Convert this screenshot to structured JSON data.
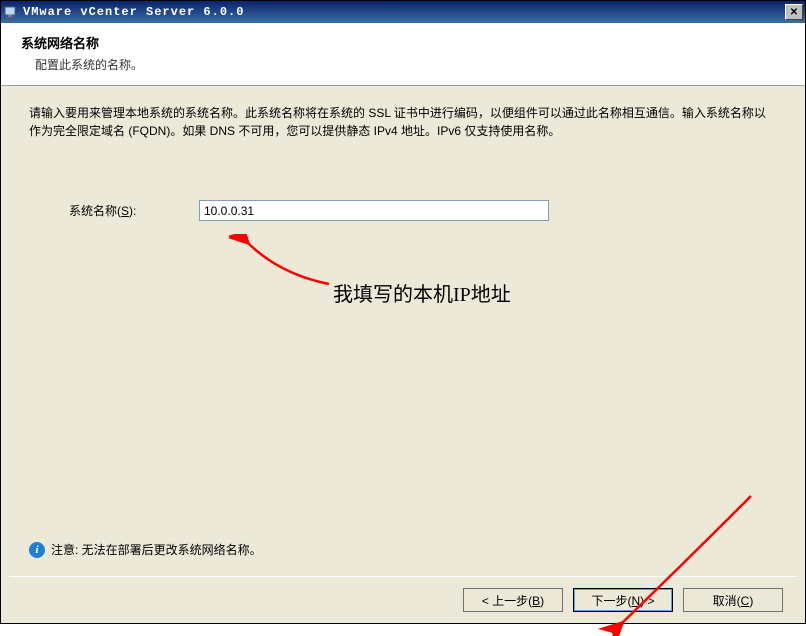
{
  "titlebar": {
    "text": "VMware vCenter Server 6.0.0"
  },
  "header": {
    "title": "系统网络名称",
    "subtitle": "配置此系统的名称。"
  },
  "content": {
    "description": "请输入要用来管理本地系统的系统名称。此系统名称将在系统的 SSL 证书中进行编码，以便组件可以通过此名称相互通信。输入系统名称以作为完全限定域名 (FQDN)。如果 DNS 不可用，您可以提供静态 IPv4 地址。IPv6 仅支持使用名称。",
    "form": {
      "label": "系统名称(S):",
      "value": "10.0.0.31"
    },
    "annotation": "我填写的本机IP地址",
    "note_prefix": "注意:",
    "note_text": " 无法在部署后更改系统网络名称。"
  },
  "buttons": {
    "back": "< 上一步(B)",
    "next": "下一步(N) >",
    "cancel": "取消(C)"
  }
}
